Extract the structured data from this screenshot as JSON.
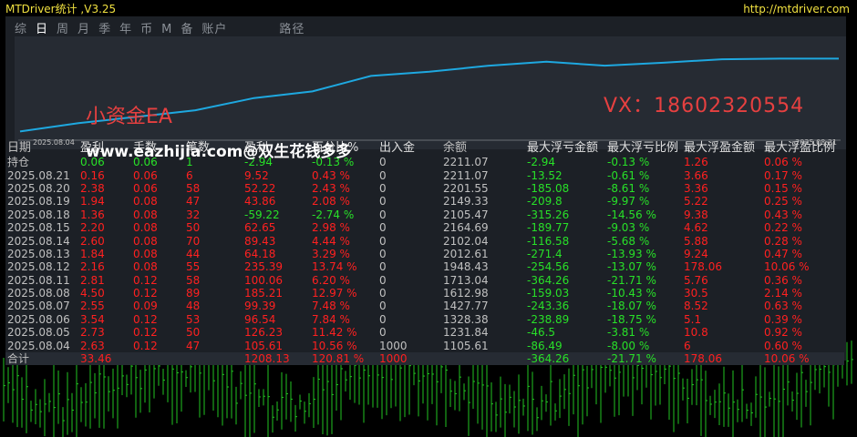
{
  "window": {
    "title": "MTDriver统计 ,V3.25",
    "url": "http://mtdriver.com"
  },
  "tabs": [
    "综",
    "日",
    "周",
    "月",
    "季",
    "年",
    "币",
    "M",
    "备",
    "账户",
    "路径"
  ],
  "active_tab": "日",
  "equity_chart": {
    "x_start": "2025.08.04",
    "x_end": "2025.08.21",
    "line_color": "#1ea8e0",
    "values": [
      1105.61,
      1231.84,
      1328.38,
      1427.77,
      1612.98,
      1713.04,
      1948.43,
      2012.61,
      2102.04,
      2164.69,
      2105.47,
      2149.33,
      2201.55,
      2211.07,
      2211.07
    ]
  },
  "watermarks": {
    "left": "小资金EA",
    "right": "VX：18602320554",
    "overlay": "www.eazhijia.com@双生花钱多多"
  },
  "table": {
    "headers": [
      "日期",
      "盈利",
      "手数",
      "笔数",
      "盈利",
      "百分比%",
      "出入金",
      "余额",
      "最大浮亏金额",
      "最大浮亏比例",
      "最大浮盈金额",
      "最大浮盈比例"
    ],
    "rows": [
      [
        "持仓",
        "0.06",
        "0.06",
        "1",
        "-2.94",
        "-0.13 %",
        "0",
        "2211.07",
        "-2.94",
        "-0.13 %",
        "1.26",
        "0.06 %"
      ],
      [
        "2025.08.21",
        "0.16",
        "0.06",
        "6",
        "9.52",
        "0.43 %",
        "0",
        "2211.07",
        "-13.52",
        "-0.61 %",
        "3.66",
        "0.17 %"
      ],
      [
        "2025.08.20",
        "2.38",
        "0.06",
        "58",
        "52.22",
        "2.43 %",
        "0",
        "2201.55",
        "-185.08",
        "-8.61 %",
        "3.36",
        "0.15 %"
      ],
      [
        "2025.08.19",
        "1.94",
        "0.08",
        "47",
        "43.86",
        "2.08 %",
        "0",
        "2149.33",
        "-209.8",
        "-9.97 %",
        "5.22",
        "0.25 %"
      ],
      [
        "2025.08.18",
        "1.36",
        "0.08",
        "32",
        "-59.22",
        "-2.74 %",
        "0",
        "2105.47",
        "-315.26",
        "-14.56 %",
        "9.38",
        "0.43 %"
      ],
      [
        "2025.08.15",
        "2.20",
        "0.08",
        "50",
        "62.65",
        "2.98 %",
        "0",
        "2164.69",
        "-189.77",
        "-9.03 %",
        "4.62",
        "0.22 %"
      ],
      [
        "2025.08.14",
        "2.60",
        "0.08",
        "70",
        "89.43",
        "4.44 %",
        "0",
        "2102.04",
        "-116.58",
        "-5.68 %",
        "5.88",
        "0.28 %"
      ],
      [
        "2025.08.13",
        "1.84",
        "0.08",
        "44",
        "64.18",
        "3.29 %",
        "0",
        "2012.61",
        "-271.4",
        "-13.93 %",
        "9.24",
        "0.47 %"
      ],
      [
        "2025.08.12",
        "2.16",
        "0.08",
        "55",
        "235.39",
        "13.74 %",
        "0",
        "1948.43",
        "-254.56",
        "-13.07 %",
        "178.06",
        "10.06 %"
      ],
      [
        "2025.08.11",
        "2.81",
        "0.12",
        "58",
        "100.06",
        "6.20 %",
        "0",
        "1713.04",
        "-364.26",
        "-21.71 %",
        "5.76",
        "0.36 %"
      ],
      [
        "2025.08.08",
        "4.50",
        "0.12",
        "89",
        "185.21",
        "12.97 %",
        "0",
        "1612.98",
        "-159.03",
        "-10.43 %",
        "30.5",
        "2.14 %"
      ],
      [
        "2025.08.07",
        "2.55",
        "0.09",
        "48",
        "99.39",
        "7.48 %",
        "0",
        "1427.77",
        "-243.36",
        "-18.07 %",
        "8.52",
        "0.63 %"
      ],
      [
        "2025.08.06",
        "3.54",
        "0.12",
        "53",
        "96.54",
        "7.84 %",
        "0",
        "1328.38",
        "-238.89",
        "-18.75 %",
        "5.1",
        "0.39 %"
      ],
      [
        "2025.08.05",
        "2.73",
        "0.12",
        "50",
        "126.23",
        "11.42 %",
        "0",
        "1231.84",
        "-46.5",
        "-3.81 %",
        "10.8",
        "0.92 %"
      ],
      [
        "2025.08.04",
        "2.63",
        "0.12",
        "47",
        "105.61",
        "10.56 %",
        "1000",
        "1105.61",
        "-86.49",
        "-8.00 %",
        "6",
        "0.60 %"
      ]
    ],
    "total": [
      "合计",
      "33.46",
      "",
      "",
      "1208.13",
      "120.81 %",
      "1000",
      "",
      "-364.26",
      "-21.71 %",
      "178.06",
      "10.06 %"
    ]
  },
  "colors": {
    "profit": "#ff2020",
    "loss": "#28e028",
    "neutral": "#c0c0c0",
    "title": "#f0e040"
  }
}
